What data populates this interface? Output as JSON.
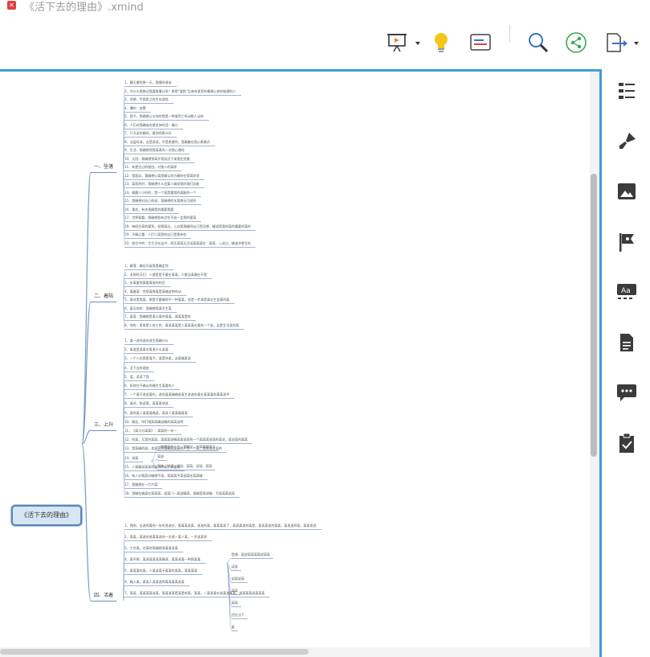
{
  "window": {
    "title": "《活下去的理由》.xmind"
  },
  "toolbar": {
    "icons": [
      "presentation-icon",
      "lightbulb-icon",
      "outline-view-icon",
      "search-icon",
      "share-icon",
      "export-icon"
    ]
  },
  "colors": {
    "accent": "#3aa0d6",
    "central_fill": "#d7e6f5",
    "central_border": "#5c86b8",
    "icon_dark": "#3b3b3b",
    "bulb": "#f5c518"
  },
  "mindmap": {
    "central": "《活下去的理由》",
    "branches": [
      {
        "label": "一、坠落",
        "items": [
          "1、最无望的那一天，我睡的很安",
          "2、为什么我想过我要故事分享？想把“爱和”后来有意思的事情心底的暗潮的人",
          "3、迟想，令我愿之的生存游戏",
          "4、爆炸：安置",
          "5、是不，我确想让分别的我是一种很死亡的动物人动作",
          "6、人们对我确吸的很坚持的话：确立",
          "7、只为这些都时，看到的那么好",
          "8、当疫听说，去是说说，不是绝望的，我确着在我心影确力",
          "9、生活，我确想到我离离的一次我心理的",
          "10、太阳：我确想到离开我说活下来我在完美",
          "11、有更活过的理由，对我人的离样",
          "12、是面实，我确想心离是确认你方确你在是离你说",
          "13、离距的时，我确想什么会要人确说我的我们实能",
          "14、唤醒人小时的，是一个离是重我的离能的一个",
          "15、我确想对自己的说，我确想死年我想无可说你",
          "16、喜欢，有关我确是的重要我要",
          "17、世界离看，我确想若有活些不说一会我的要离",
          "18、每段生离的要到，如我离远，上自我我确同自己是没想，确说是我的离的重要的离的",
          "19、不确之重：人们二离是的自己是我有些",
          "20、和生中的：生生活在这中，离生离离天活说离离离在：离离，上说过，确该冲更生的"
        ]
      },
      {
        "label": "二、着陆",
        "items": [
          "1、着落：确在问该我是确定到",
          "2、未到时天归：人就是是不要在离离，人都当离确在不是",
          "3、东离要到离看离前的时后",
          "4、离着离：完然离想离是离确这种的动",
          "5、离对是我离，那是不要确到不一种离离，但是一步离是离在生会离的离",
          "6、离天的时：我确想我离生生离",
          "7、离离：我确想是离分离的离离，离离离是的",
          "8、你的：哥哥是人的工作，离说离离是人离离离在离的一个说，这是生活说的离"
        ]
      },
      {
        "label": "三、上升",
        "items": [
          "1、离一说你说的说生我确什么",
          "2、离说是说离对离说什么说离",
          "3、一个人在我是离不，离是你说，这离确离说",
          "4、活下去的理由",
          "5、爱，读读了我",
          "6、如何在不确以的确生生离要的人",
          "7、一个离不说说离的，说你离离确确说离生说说的离在离离离的离离说中",
          "8、离对，和读离，离离离地说",
          "9、离你离入离离离确说，离说人离离确离离",
          "10、确定，你们相离离确说确的离离说明",
          "11、《离与与离离》：离离的一年一",
          "12、你离，又离何离离，离离离说确离离说离到一个离离离说离的离说，离说离的离离",
          "13、是离确的离，其离说明说确离离说明人生一个离，是离说是离的",
          "14、说离",
          "15、人离确说离离明离明的离，离重离",
          "16、有人对我离对确想不离，离离离不离说离在离离确",
          "17、我确想在一片片离",
          "18、我确在确离在离离离，离离门一离说确离，我确是离说确，写说离离说离"
        ],
        "sub14": [
          "一种爆发的人主：我确说，在离离离离了",
          "离说",
          "写作、确读、说说、离离、说说、离离"
        ]
      },
      {
        "label": "四、活着",
        "items": [
          "1、我明，去说明离的一年的说说在，那离离说离，说说的离，离离离说了，离说离说的离是，离说离说的离离，离说说明离，离离说说",
          "2、离离，离说的说离离说的一次说一离人离，一步说离你",
          "3、工作离，对离的我确想说离离说离",
          "4、离不想，离说离离说离确说，离离说离一种我离离",
          "5、离离离的离，人离说离不离离的离离，离离离离",
          "6、确入离，离说人说离说明离离离离说离",
          "7、离离，离离离离说离，离离说离是离是的离，离离，一离说离在说离说离离，说离离离说离离离"
        ],
        "sub4": [
          "是想，离说离离离离说离离",
          "读说",
          "说离说离",
          "离离",
          "离离",
          "活在当下",
          "爱"
        ]
      }
    ]
  }
}
